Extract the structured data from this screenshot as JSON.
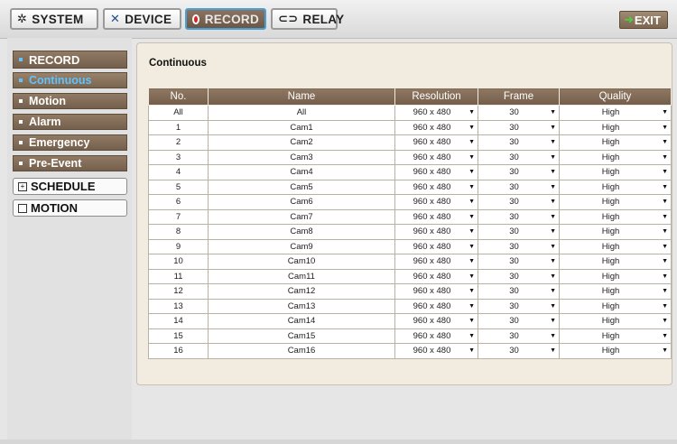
{
  "topbar": {
    "system_label": "SYSTEM",
    "device_label": "DEVICE",
    "record_label": "RECORD",
    "relay_label": "RELAY",
    "exit_label": "EXIT"
  },
  "sidebar": {
    "record": "RECORD",
    "continuous": "Continuous",
    "motion": "Motion",
    "alarm": "Alarm",
    "emergency": "Emergency",
    "pre_event": "Pre-Event",
    "schedule": "SCHEDULE",
    "motion_section": "MOTION"
  },
  "panel": {
    "title": "Continuous",
    "headers": [
      "No.",
      "Name",
      "Resolution",
      "Frame",
      "Quality"
    ],
    "rows": [
      {
        "no": "All",
        "name": "All",
        "resolution": "960 x 480",
        "frame": "30",
        "quality": "High"
      },
      {
        "no": "1",
        "name": "Cam1",
        "resolution": "960 x 480",
        "frame": "30",
        "quality": "High"
      },
      {
        "no": "2",
        "name": "Cam2",
        "resolution": "960 x 480",
        "frame": "30",
        "quality": "High"
      },
      {
        "no": "3",
        "name": "Cam3",
        "resolution": "960 x 480",
        "frame": "30",
        "quality": "High"
      },
      {
        "no": "4",
        "name": "Cam4",
        "resolution": "960 x 480",
        "frame": "30",
        "quality": "High"
      },
      {
        "no": "5",
        "name": "Cam5",
        "resolution": "960 x 480",
        "frame": "30",
        "quality": "High"
      },
      {
        "no": "6",
        "name": "Cam6",
        "resolution": "960 x 480",
        "frame": "30",
        "quality": "High"
      },
      {
        "no": "7",
        "name": "Cam7",
        "resolution": "960 x 480",
        "frame": "30",
        "quality": "High"
      },
      {
        "no": "8",
        "name": "Cam8",
        "resolution": "960 x 480",
        "frame": "30",
        "quality": "High"
      },
      {
        "no": "9",
        "name": "Cam9",
        "resolution": "960 x 480",
        "frame": "30",
        "quality": "High"
      },
      {
        "no": "10",
        "name": "Cam10",
        "resolution": "960 x 480",
        "frame": "30",
        "quality": "High"
      },
      {
        "no": "11",
        "name": "Cam11",
        "resolution": "960 x 480",
        "frame": "30",
        "quality": "High"
      },
      {
        "no": "12",
        "name": "Cam12",
        "resolution": "960 x 480",
        "frame": "30",
        "quality": "High"
      },
      {
        "no": "13",
        "name": "Cam13",
        "resolution": "960 x 480",
        "frame": "30",
        "quality": "High"
      },
      {
        "no": "14",
        "name": "Cam14",
        "resolution": "960 x 480",
        "frame": "30",
        "quality": "High"
      },
      {
        "no": "15",
        "name": "Cam15",
        "resolution": "960 x 480",
        "frame": "30",
        "quality": "High"
      },
      {
        "no": "16",
        "name": "Cam16",
        "resolution": "960 x 480",
        "frame": "30",
        "quality": "High"
      }
    ]
  },
  "icons": {
    "system": "gear-icon",
    "device": "tools-icon",
    "record": "record-dot-icon",
    "relay": "relay-icon",
    "exit": "exit-arrow-icon",
    "dropdown": "dropdown-arrow-icon"
  },
  "colors": {
    "brown": "#7f6a55",
    "accent_blue": "#5fc3ff",
    "record_red": "#e02020",
    "exit_green": "#49d03f",
    "panel_bg": "#f2ebdf"
  }
}
